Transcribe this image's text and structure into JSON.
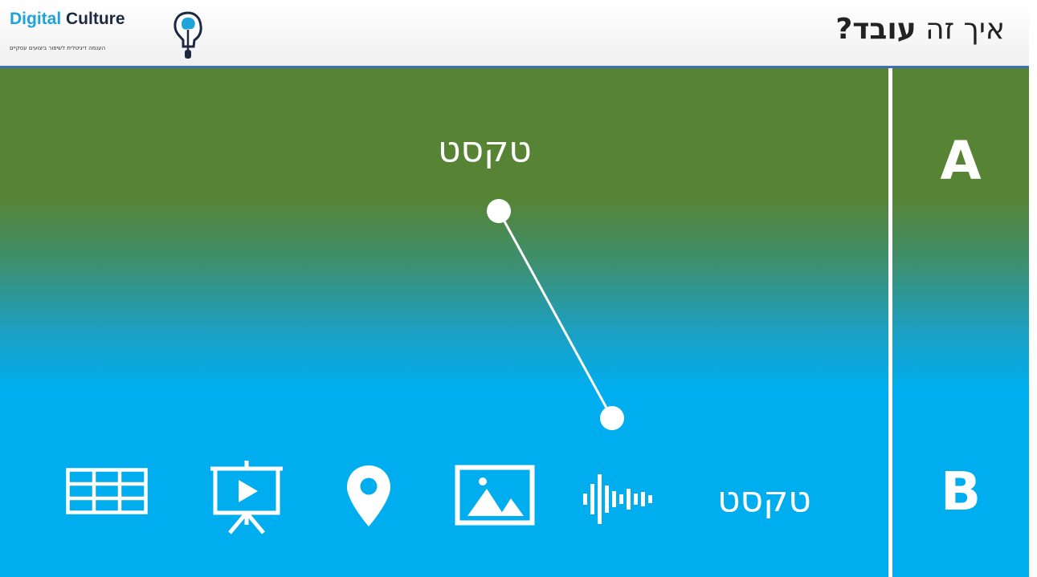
{
  "header": {
    "logo": {
      "word1": "Digital",
      "word2": "Culture",
      "tagline": "הענמה דיגיטלית לשיפור ביצועים עסקיים",
      "icon": "head-icon"
    },
    "title_light": "איך זה",
    "title_bold": "עובד?"
  },
  "labels": {
    "a": "A",
    "b": "B"
  },
  "texts": {
    "top": "טקסט",
    "bottom": "טקסט"
  },
  "icons": [
    "table-icon",
    "presentation-icon",
    "location-pin-icon",
    "image-icon",
    "audio-waveform-icon"
  ],
  "colors": {
    "top_green": "#578434",
    "bottom_blue": "#00aeef",
    "header_rule": "#3f6fae",
    "logo_cyan": "#1fa3d8",
    "logo_navy": "#1c2940",
    "foreground": "#ffffff"
  }
}
